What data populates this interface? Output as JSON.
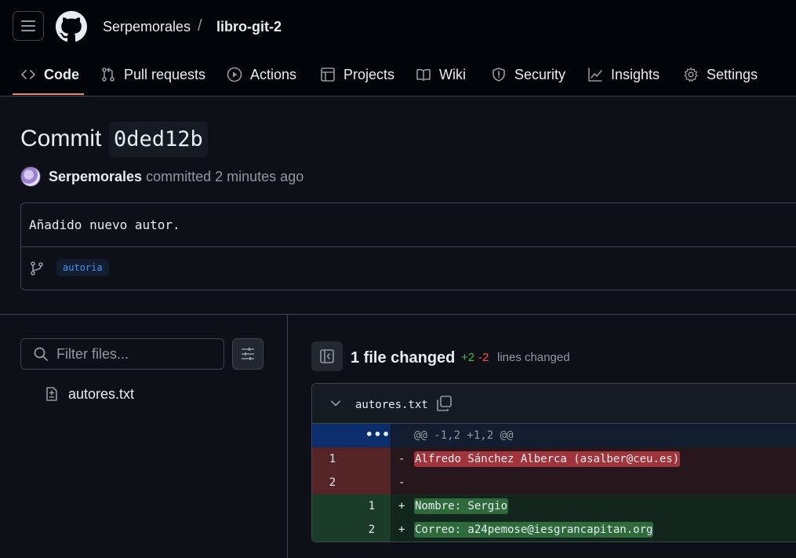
{
  "header": {
    "owner": "Serpemorales",
    "separator": "/",
    "repo": "libro-git-2"
  },
  "nav": {
    "tabs": [
      {
        "label": "Code",
        "icon": "code-icon",
        "active": true
      },
      {
        "label": "Pull requests",
        "icon": "pull-request-icon"
      },
      {
        "label": "Actions",
        "icon": "play-icon"
      },
      {
        "label": "Projects",
        "icon": "table-icon"
      },
      {
        "label": "Wiki",
        "icon": "book-icon"
      },
      {
        "label": "Security",
        "icon": "shield-icon"
      },
      {
        "label": "Insights",
        "icon": "graph-icon"
      },
      {
        "label": "Settings",
        "icon": "gear-icon"
      }
    ],
    "accent_color": "#f78166"
  },
  "commit": {
    "title_prefix": "Commit",
    "sha": "0ded12b",
    "author": "Serpemorales",
    "action": "committed",
    "time": "2 minutes ago",
    "message": "Añadido nuevo autor.",
    "branch": "autoria"
  },
  "sidebar": {
    "filter_placeholder": "Filter files...",
    "files": [
      "autores.txt"
    ]
  },
  "summary": {
    "files_changed": "1 file changed",
    "additions": "+2",
    "deletions": "-2",
    "lines_changed": "lines changed"
  },
  "diff": {
    "file": "autores.txt",
    "hunk": "@@ -1,2 +1,2 @@",
    "lines": [
      {
        "type": "del",
        "old": "1",
        "new": "",
        "sign": "-",
        "text": "Alfredo Sánchez Alberca (asalber@ceu.es)"
      },
      {
        "type": "del",
        "old": "2",
        "new": "",
        "sign": "-",
        "text": ""
      },
      {
        "type": "add",
        "old": "",
        "new": "1",
        "sign": "+",
        "text": "Nombre: Sergio"
      },
      {
        "type": "add",
        "old": "",
        "new": "2",
        "sign": "+",
        "text": "Correo: a24pemose@iesgrancapitan.org"
      }
    ],
    "colors": {
      "addition": "#3fb950",
      "deletion": "#f85149"
    }
  }
}
